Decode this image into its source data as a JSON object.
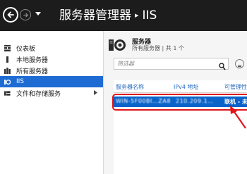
{
  "window": {
    "title_app": "服务器管理器",
    "title_separator": "▸",
    "title_page": "IIS"
  },
  "sidebar": {
    "items": [
      {
        "label": "仪表板",
        "icon": "dashboard-icon"
      },
      {
        "label": "本地服务器",
        "icon": "local-server-icon"
      },
      {
        "label": "所有服务器",
        "icon": "all-servers-icon"
      },
      {
        "label": "IIS",
        "icon": "iis-icon",
        "selected": true
      },
      {
        "label": "文件和存储服务",
        "icon": "file-storage-icon",
        "has_arrow": true
      }
    ]
  },
  "main": {
    "header": {
      "title": "服务器",
      "subtitle": "所有服务器 | 共 1 个",
      "icon": "server-icon"
    },
    "filter": {
      "placeholder": "筛选器"
    },
    "table": {
      "columns": [
        "服务器名称",
        "IPv4 地址",
        "可管理性"
      ],
      "rows": [
        {
          "server_name": "WIN-5F00BI…ZA8",
          "ipv4": "210.209.1…",
          "manageability": "联机 - 未"
        }
      ]
    }
  },
  "colors": {
    "titlebar": "#1c1c1c",
    "selection": "#1e6bd4",
    "row_selected": "#0a63c9",
    "column_header": "#2a6bbd",
    "highlight": "#e0151a"
  }
}
